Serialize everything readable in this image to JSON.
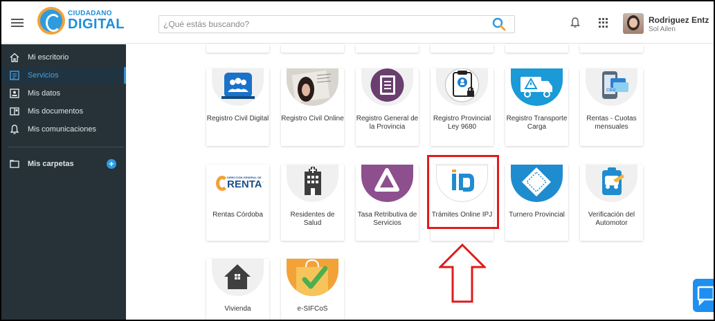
{
  "app": {
    "logo_small": "CIUDADANO",
    "logo_big": "DIGITAL"
  },
  "search": {
    "placeholder": "¿Qué estás buscando?"
  },
  "user": {
    "name": "Rodriguez Entz",
    "subtitle": "Sol Ailen"
  },
  "sidebar": {
    "items": [
      {
        "label": "Mi escritorio",
        "icon": "home-icon"
      },
      {
        "label": "Servicios",
        "icon": "list-icon",
        "active": true
      },
      {
        "label": "Mis datos",
        "icon": "id-card-icon"
      },
      {
        "label": "Mis documentos",
        "icon": "documents-icon"
      },
      {
        "label": "Mis comunicaciones",
        "icon": "bell-icon"
      }
    ],
    "folders_label": "Mis carpetas"
  },
  "services": {
    "row1": [
      {
        "label": "Registro Civil Digital",
        "icon": "people-icon"
      },
      {
        "label": "Registro Civil Online",
        "icon": "id-photo-icon"
      },
      {
        "label": "Registro General de la Provincia",
        "icon": "book-icon"
      },
      {
        "label": "Registro Provincial Ley 9680",
        "icon": "secure-clipboard-icon"
      },
      {
        "label": "Registro Transporte Carga",
        "icon": "truck-icon"
      },
      {
        "label": "Rentas - Cuotas mensuales",
        "icon": "cbu-phone-icon"
      }
    ],
    "row2": [
      {
        "label": "Rentas Córdoba",
        "icon": "rentas-logo-icon",
        "logo_small": "DIRECCIÓN GENERAL DE",
        "logo_big": "RENTAS"
      },
      {
        "label": "Residentes de Salud",
        "icon": "hospital-icon"
      },
      {
        "label": "Tasa Retributiva de Servicios",
        "icon": "triangle-logo-icon"
      },
      {
        "label": "Trámites Online IPJ",
        "icon": "ipj-logo-icon",
        "highlighted": true
      },
      {
        "label": "Turnero Provincial",
        "icon": "ticket-icon"
      },
      {
        "label": "Verificación del Automotor",
        "icon": "car-check-icon"
      }
    ],
    "row3": [
      {
        "label": "Vivienda",
        "icon": "house-icon"
      },
      {
        "label": "e-SIFCoS",
        "icon": "shopping-bag-check-icon"
      }
    ]
  },
  "colors": {
    "sidebar_bg": "#263238",
    "accent": "#2d9be0",
    "highlight": "#e01b1b",
    "chat": "#1e8ff0"
  }
}
